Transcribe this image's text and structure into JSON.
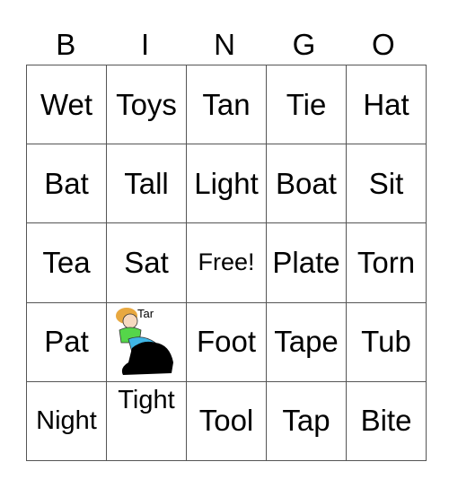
{
  "header": [
    "B",
    "I",
    "N",
    "G",
    "O"
  ],
  "rows": [
    [
      "Wet",
      "Toys",
      "Tan",
      "Tie",
      "Hat"
    ],
    [
      "Bat",
      "Tall",
      "Light",
      "Boat",
      "Sit"
    ],
    [
      "Tea",
      "Sat",
      "Free!",
      "Plate",
      "Torn"
    ],
    [
      "Pat",
      "",
      "Foot",
      "Tape",
      "Tub"
    ],
    [
      "Night",
      "Tight",
      "Tool",
      "Tap",
      "Bite"
    ]
  ],
  "image_cell": {
    "label": "Tar",
    "icon": "tar-cartoon-icon"
  }
}
